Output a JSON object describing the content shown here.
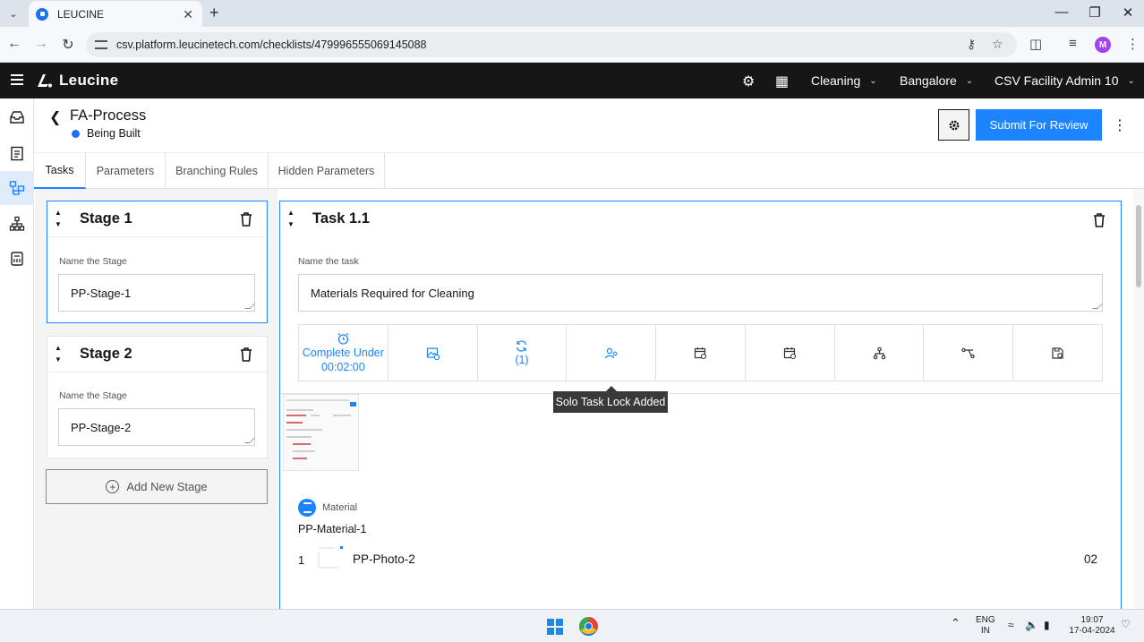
{
  "browser": {
    "tab_title": "LEUCINE",
    "url": "csv.platform.leucinetech.com/checklists/479996555069145088",
    "profile_initial": "M"
  },
  "appbar": {
    "brand": "Leucine",
    "use_case": "Cleaning",
    "facility": "Bangalore",
    "user": "CSV Facility Admin 10"
  },
  "page": {
    "title": "FA-Process",
    "status": "Being Built",
    "submit_label": "Submit For Review"
  },
  "tabs": [
    "Tasks",
    "Parameters",
    "Branching Rules",
    "Hidden Parameters"
  ],
  "stages": [
    {
      "heading": "Stage 1",
      "field_label": "Name the Stage",
      "value": "PP-Stage-1"
    },
    {
      "heading": "Stage 2",
      "field_label": "Name the Stage",
      "value": "PP-Stage-2"
    }
  ],
  "add_stage_label": "Add New Stage",
  "task": {
    "heading": "Task 1.1",
    "field_label": "Name the task",
    "value": "Materials Required for Cleaning",
    "timer_line1": "Complete Under",
    "timer_line2": "00:02:00",
    "recurrence_count": "(1)",
    "tooltip": "Solo Task Lock Added"
  },
  "material": {
    "section_label": "Material",
    "name": "PP-Material-1",
    "row_index": "1",
    "row_name": "PP-Photo-2",
    "row_qty": "02"
  },
  "taskbar": {
    "lang_line1": "ENG",
    "lang_line2": "IN",
    "time": "19:07",
    "date": "17-04-2024"
  },
  "colors": {
    "accent": "#1d84ff",
    "header_bg": "#161616",
    "status_dot": "#1d70f5"
  }
}
